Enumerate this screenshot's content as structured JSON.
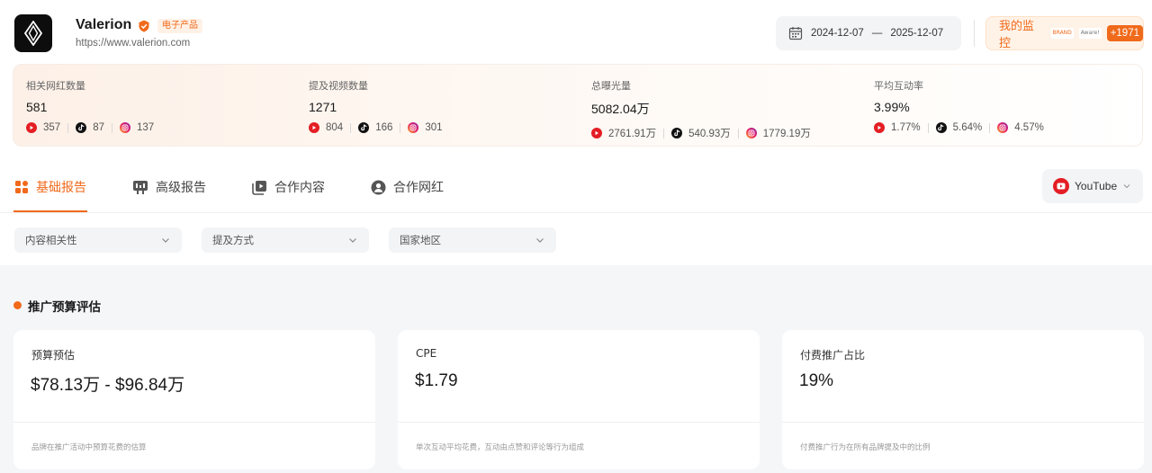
{
  "brand": {
    "name": "Valerion",
    "category_badge": "电子产品",
    "url": "https://www.valerion.com"
  },
  "date_range": {
    "start": "2024-12-07",
    "separator": "—",
    "end": "2025-12-07"
  },
  "monitor": {
    "label": "我的监控",
    "brand_1": "BRAND",
    "brand_2": "Aware!",
    "count": "+1971"
  },
  "stats": [
    {
      "title": "相关网红数量",
      "value": "581",
      "youtube": "357",
      "tiktok": "87",
      "instagram": "137"
    },
    {
      "title": "提及视频数量",
      "value": "1271",
      "youtube": "804",
      "tiktok": "166",
      "instagram": "301"
    },
    {
      "title": "总曝光量",
      "value": "5082.04万",
      "youtube": "2761.91万",
      "tiktok": "540.93万",
      "instagram": "1779.19万"
    },
    {
      "title": "平均互动率",
      "value": "3.99%",
      "youtube": "1.77%",
      "tiktok": "5.64%",
      "instagram": "4.57%"
    }
  ],
  "tabs": [
    {
      "label": "基础报告",
      "icon": "grid-icon",
      "active": true
    },
    {
      "label": "高级报告",
      "icon": "report-icon",
      "active": false
    },
    {
      "label": "合作内容",
      "icon": "content-icon",
      "active": false
    },
    {
      "label": "合作网红",
      "icon": "user-icon",
      "active": false
    }
  ],
  "platform_select": {
    "value": "YouTube"
  },
  "filters": [
    {
      "label": "内容相关性"
    },
    {
      "label": "提及方式"
    },
    {
      "label": "国家地区"
    }
  ],
  "section": {
    "title": "推广预算评估"
  },
  "cards": [
    {
      "title": "预算预估",
      "value": "$78.13万 - $96.84万",
      "desc": "品牌在推广活动中预算花费的估算"
    },
    {
      "title": "CPE",
      "value": "$1.79",
      "desc": "单次互动平均花费，互动由点赞和评论等行为组成"
    },
    {
      "title": "付费推广占比",
      "value": "19%",
      "desc": "付费推广行为在所有品牌提及中的比例"
    }
  ],
  "colors": {
    "accent": "#f06a1b",
    "youtube": "#e31e24",
    "tiktok": "#111111"
  }
}
